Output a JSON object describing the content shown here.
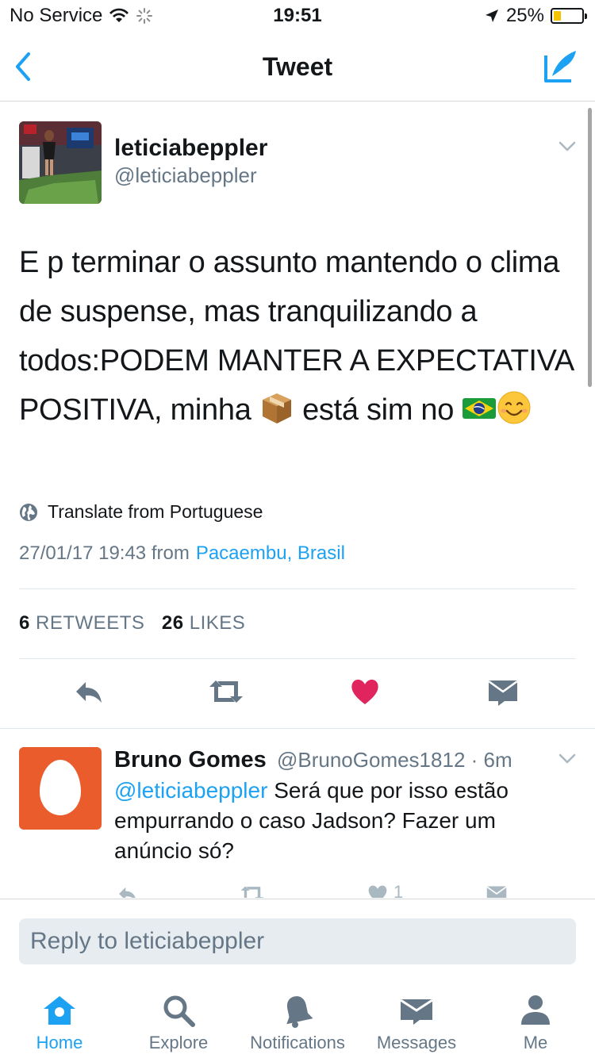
{
  "status_bar": {
    "carrier": "No Service",
    "time": "19:51",
    "battery": "25%",
    "battery_level": 0.25
  },
  "nav": {
    "title": "Tweet",
    "back_icon": "chevron-left-icon",
    "compose_icon": "compose-quill-icon"
  },
  "tweet": {
    "author_name": "leticiabeppler",
    "author_handle": "@leticiabeppler",
    "text_part1": "E p terminar o assunto mantendo o clima de suspense, mas tranquilizando a todos:PODEM MANTER A EXPECTATIVA POSITIVA, minha",
    "text_part2": "está sim no",
    "emojis": [
      "package-emoji",
      "brazil-flag-emoji",
      "smiling-face-emoji"
    ],
    "translate": "Translate from Portuguese",
    "timestamp": "27/01/17 19:43 from",
    "location": "Pacaembu, Brasil",
    "retweets_count": "6",
    "retweets_label": "RETWEETS",
    "likes_count": "26",
    "likes_label": "LIKES"
  },
  "reply": {
    "author_name": "Bruno Gomes",
    "author_handle": "@BrunoGomes1812",
    "time": "· 6m",
    "mention": "@leticiabeppler",
    "text": "Será que por isso estão empurrando o caso Jadson? Fazer um anúncio só?",
    "like_count": "1"
  },
  "composer": {
    "placeholder": "Reply to leticiabeppler"
  },
  "tabs": [
    {
      "label": "Home",
      "icon": "home-icon",
      "active": true
    },
    {
      "label": "Explore",
      "icon": "search-icon",
      "active": false
    },
    {
      "label": "Notifications",
      "icon": "bell-icon",
      "active": false
    },
    {
      "label": "Messages",
      "icon": "envelope-icon",
      "active": false
    },
    {
      "label": "Me",
      "icon": "person-icon",
      "active": false
    }
  ],
  "colors": {
    "accent": "#1da1f2",
    "like": "#e0245e",
    "muted": "#657786",
    "egg_avatar": "#ea5c2c"
  }
}
